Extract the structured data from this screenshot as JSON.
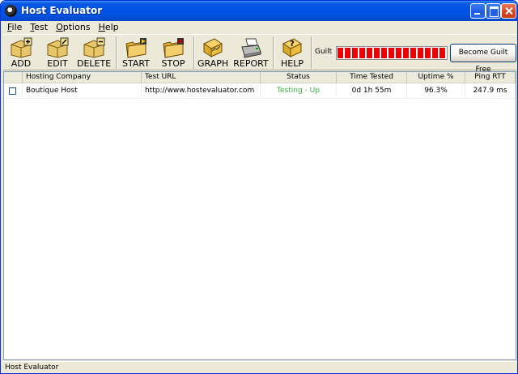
{
  "window": {
    "title": "Host Evaluator"
  },
  "menu": [
    {
      "first": "F",
      "rest": "ile"
    },
    {
      "first": "T",
      "rest": "est"
    },
    {
      "first": "O",
      "rest": "ptions"
    },
    {
      "first": "H",
      "rest": "elp"
    }
  ],
  "toolbar": {
    "add": "ADD",
    "edit": "EDIT",
    "delete": "DELETE",
    "start": "START",
    "stop": "STOP",
    "graph": "GRAPH",
    "report": "REPORT",
    "help": "HELP",
    "guilt_label": "Guilt",
    "guilt_level": 1.0,
    "guilt_color": "#ee0000",
    "guilt_free_button": "Become Guilt Free"
  },
  "list": {
    "columns": [
      "",
      "Hosting Company",
      "Test URL",
      "Status",
      "Time Tested",
      "Uptime %",
      "Ping RTT"
    ],
    "rows": [
      {
        "checked": false,
        "company": "Boutique Host",
        "url": "http://www.hostevaluator.com",
        "status": "Testing - Up",
        "status_color": "#3cb03c",
        "time_tested": "0d 1h 55m",
        "uptime": "96.3%",
        "ping": "247.9 ms"
      }
    ]
  },
  "statusbar": {
    "text": "Host Evaluator"
  }
}
